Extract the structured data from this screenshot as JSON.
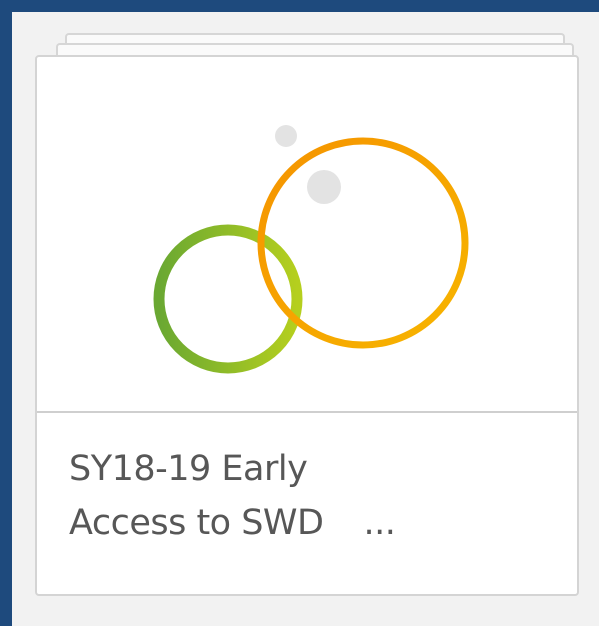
{
  "app": {
    "card": {
      "title_line1": "SY18-19 Early",
      "title_line2": "Access to SWD",
      "ellipsis": "...",
      "thumbnail_icon": "overlapping-circles-icon"
    }
  },
  "colors": {
    "background": "#1e4a7d",
    "panel": "#f2f2f2",
    "card": "#ffffff",
    "border": "#d4d4d4",
    "title_text": "#575757",
    "green_ring": "#7ab32e",
    "orange_ring": "#f5a300",
    "grey_dot": "#e0e0e0"
  }
}
